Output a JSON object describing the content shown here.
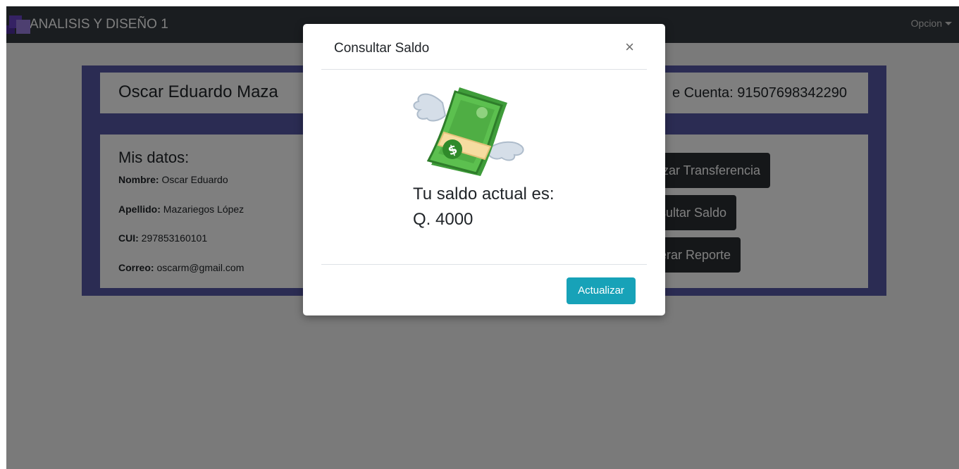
{
  "navbar": {
    "brand": "ANALISIS Y DISEÑO 1",
    "menu_label": "Opcion"
  },
  "profile": {
    "owner_name": "Oscar Eduardo Maza",
    "account_label": "e Cuenta: 91507698342290",
    "section_title": "Mis datos:",
    "fields": [
      {
        "label": "Nombre:",
        "value": "Oscar Eduardo"
      },
      {
        "label": "Apellido:",
        "value": "Mazariegos López"
      },
      {
        "label": "CUI:",
        "value": "297853160101"
      },
      {
        "label": "Correo:",
        "value": "oscarm@gmail.com"
      }
    ],
    "actions": {
      "transfer": "izar Transferencia",
      "balance": "sultar Saldo",
      "report": "erar Reporte"
    }
  },
  "modal": {
    "title": "Consultar Saldo",
    "close_symbol": "×",
    "balance_label": "Tu saldo actual es:",
    "balance_value": "Q. 4000",
    "update_button": "Actualizar",
    "icon": "money-with-wings-icon"
  },
  "colors": {
    "navbar": "#343a40",
    "frame": "#5659a7",
    "button_dark": "#2b2f33",
    "button_info": "#17a2b8",
    "backdrop": "rgba(0,0,0,0.5)"
  }
}
